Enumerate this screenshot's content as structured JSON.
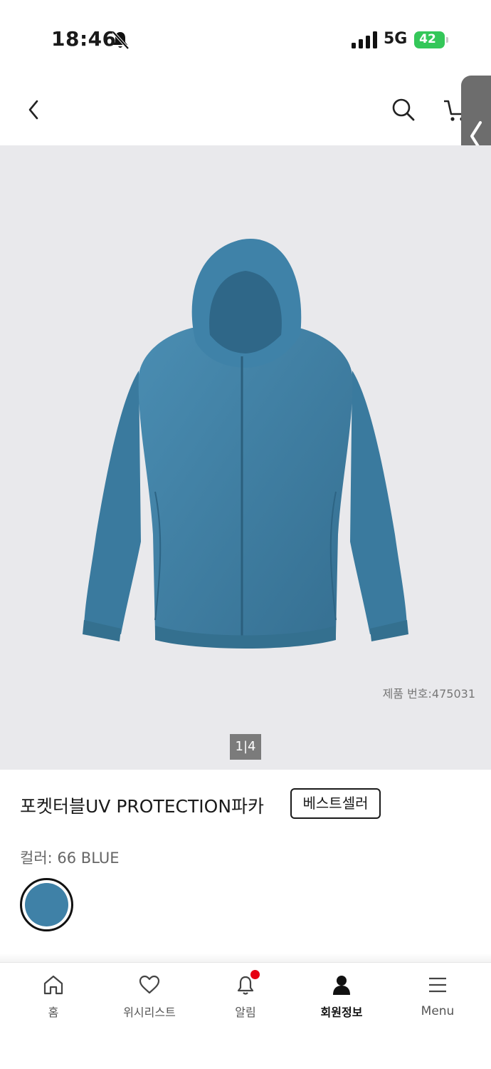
{
  "status_bar": {
    "time": "18:46",
    "network": "5G",
    "battery": "42"
  },
  "header": {
    "icons": [
      "back-arrow-icon",
      "search-icon",
      "cart-icon",
      "side-panel-chevron-icon"
    ]
  },
  "product": {
    "product_number": "제품 번호:475031",
    "image_pager": "1|4",
    "title": "포켓터블UV PROTECTION파카",
    "badge": "베스트셀러",
    "color_label": "컬러: 66 BLUE",
    "swatch_color": "#3f81a7"
  },
  "bottom_nav": {
    "items": [
      {
        "label": "홈",
        "icon": "home-icon"
      },
      {
        "label": "위시리스트",
        "icon": "heart-icon"
      },
      {
        "label": "알림",
        "icon": "bell-icon"
      },
      {
        "label": "회원정보",
        "icon": "person-icon"
      },
      {
        "label": "Menu",
        "icon": "hamburger-icon"
      }
    ]
  },
  "colors": {
    "jacket": "#3d7fa3",
    "notification_dot": "#e60012",
    "battery": "#34c759"
  }
}
